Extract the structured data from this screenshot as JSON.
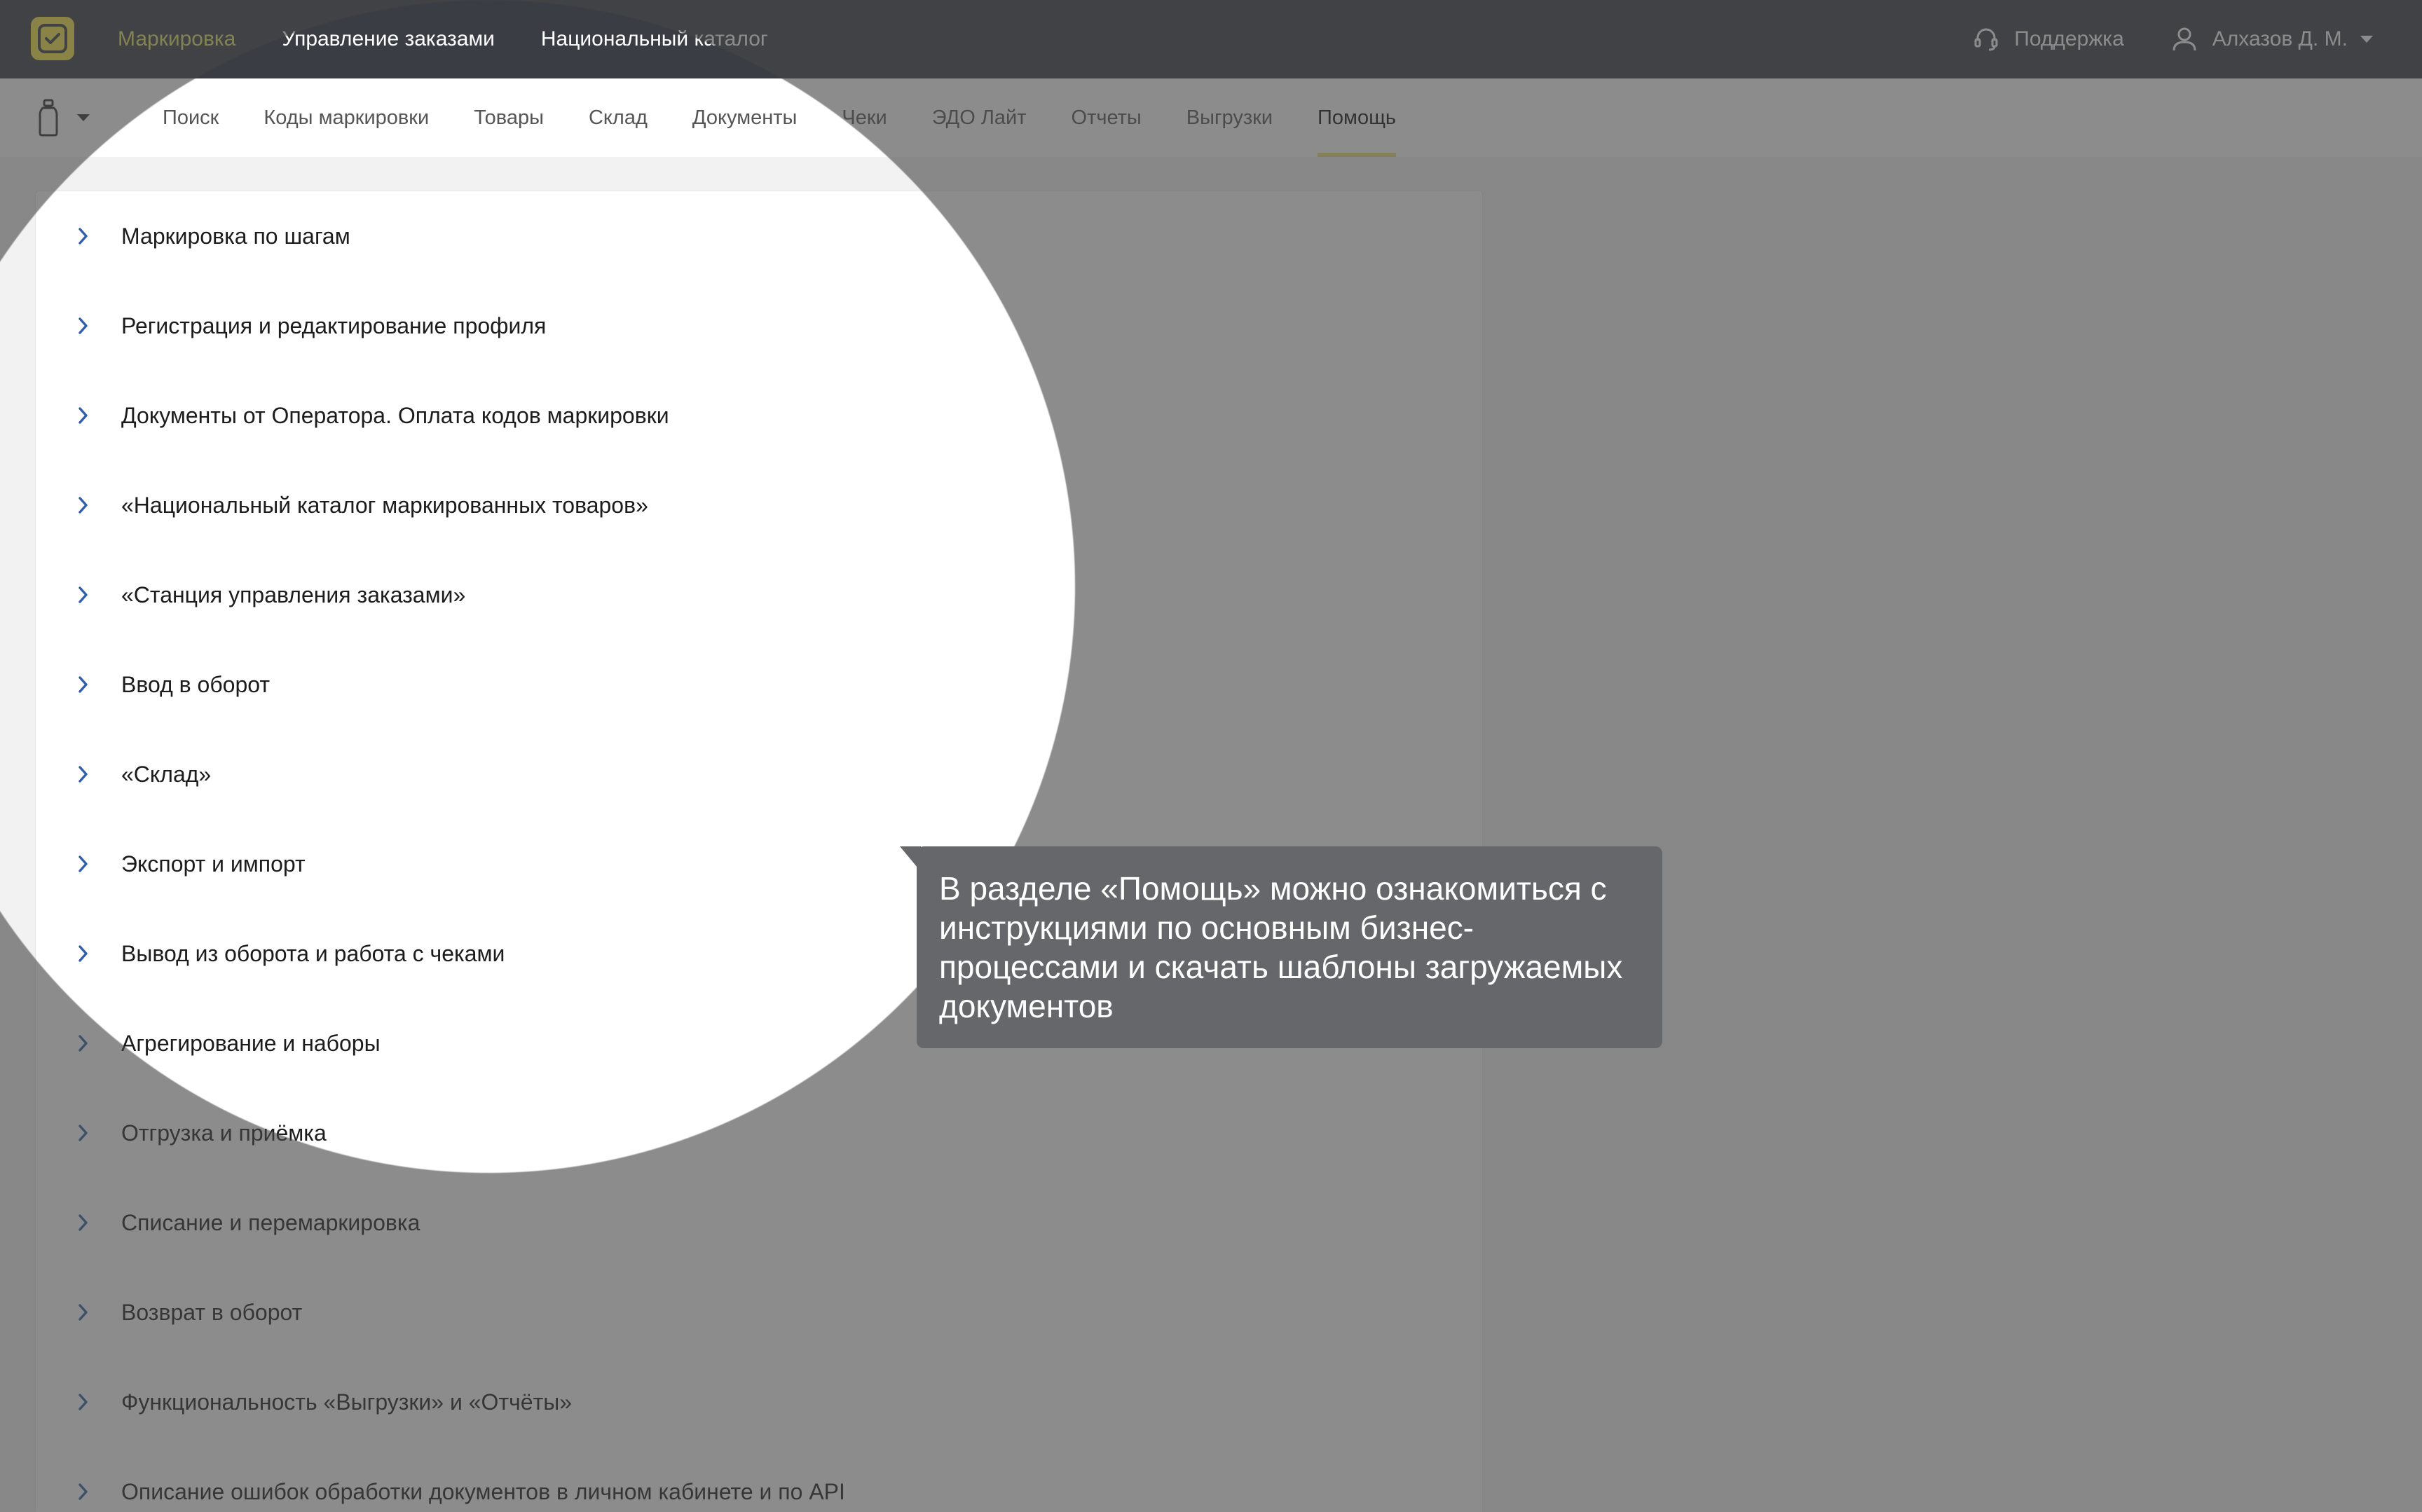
{
  "topbar": {
    "nav": [
      {
        "label": "Маркировка",
        "active": true
      },
      {
        "label": "Управление заказами",
        "active": false
      },
      {
        "label": "Национальный каталог",
        "active": false
      }
    ],
    "support_label": "Поддержка",
    "user_name": "Алхазов Д. М."
  },
  "subnav": {
    "tabs": [
      {
        "label": "Поиск"
      },
      {
        "label": "Коды маркировки"
      },
      {
        "label": "Товары"
      },
      {
        "label": "Склад"
      },
      {
        "label": "Документы"
      },
      {
        "label": "Чеки"
      },
      {
        "label": "ЭДО Лайт"
      },
      {
        "label": "Отчеты"
      },
      {
        "label": "Выгрузки"
      },
      {
        "label": "Помощь",
        "active": true
      }
    ]
  },
  "help": {
    "items": [
      "Маркировка по шагам",
      "Регистрация и редактирование профиля",
      "Документы от Оператора. Оплата кодов маркировки",
      "«Национальный каталог маркированных товаров»",
      "«Станция управления заказами»",
      "Ввод в оборот",
      "«Склад»",
      "Экспорт и импорт",
      "Вывод из оборота и работа с чеками",
      "Агрегирование и наборы",
      "Отгрузка и приёмка",
      "Списание и перемаркировка",
      "Возврат в оборот",
      "Функциональность «Выгрузки» и «Отчёты»",
      "Описание ошибок обработки документов в личном кабинете и по API"
    ]
  },
  "tooltip": {
    "text": "В разделе «Помощь» можно ознакомиться с инструкциями по основным бизнес-процессами и скачать шаблоны загружаемых документов"
  },
  "colors": {
    "topbar_bg": "#3a3d44",
    "accent": "#e5e36a",
    "logo_bg": "#f6e64a",
    "chevron": "#2f5fa8",
    "tooltip_bg": "#65676a"
  }
}
